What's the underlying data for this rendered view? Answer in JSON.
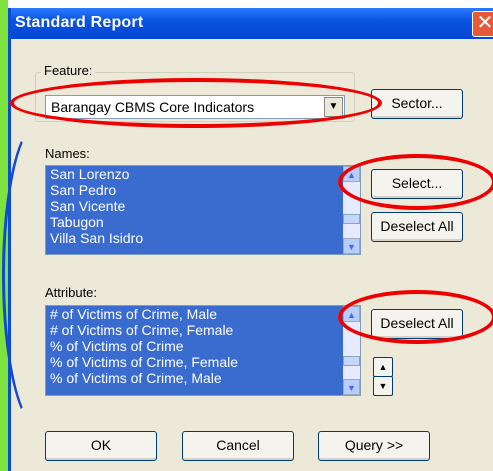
{
  "window": {
    "title": "Standard Report",
    "close_glyph": "✕"
  },
  "feature": {
    "group_label": "Feature:",
    "selected": "Barangay CBMS Core Indicators",
    "arrow": "▼",
    "sector_button": "Sector..."
  },
  "names": {
    "label": "Names:",
    "items": [
      "San Lorenzo",
      "San Pedro",
      "San Vicente",
      "Tabugon",
      "Villa San Isidro"
    ],
    "select_button": "Select...",
    "deselect_button": "Deselect All"
  },
  "attribute": {
    "label": "Attribute:",
    "items": [
      "# of Victims of Crime, Male",
      "# of Victims of Crime, Female",
      "% of Victims of Crime",
      "% of Victims of Crime, Female",
      "% of Victims of Crime, Male"
    ],
    "deselect_button": "Deselect All",
    "up_glyph": "▲",
    "down_glyph": "▼"
  },
  "footer": {
    "ok": "OK",
    "cancel": "Cancel",
    "query": "Query >>"
  },
  "colors": {
    "annotation": "#e00000",
    "selection": "#3a6ccf",
    "title_bar": "#0a53e3"
  }
}
